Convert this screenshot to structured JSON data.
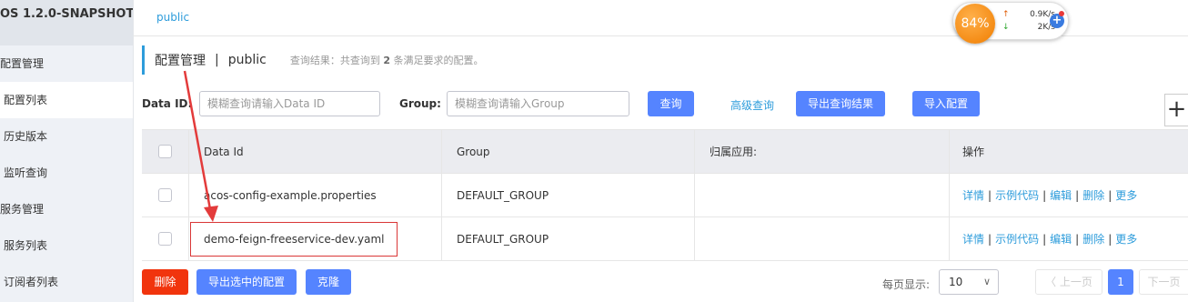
{
  "sidebar": {
    "brand": "OS 1.2.0-SNAPSHOT",
    "group_config": "配置管理",
    "items_config": [
      "配置列表",
      "历史版本",
      "监听查询"
    ],
    "group_service": "服务管理",
    "items_service": [
      "服务列表",
      "订阅者列表"
    ]
  },
  "topbar": {
    "namespace_tab": "public"
  },
  "header": {
    "title": "配置管理",
    "separator": "|",
    "namespace": "public",
    "summary_prefix": "查询结果：共查询到",
    "summary_count": "2",
    "summary_suffix": "条满足要求的配置。"
  },
  "search": {
    "data_id_label": "Data ID:",
    "data_id_placeholder": "模糊查询请输入Data ID",
    "group_label": "Group:",
    "group_placeholder": "模糊查询请输入Group",
    "query_button": "查询",
    "advanced_link": "高级查询",
    "export_results_button": "导出查询结果",
    "import_button": "导入配置",
    "add_icon": "plus-icon"
  },
  "table": {
    "columns": [
      "Data Id",
      "Group",
      "归属应用:",
      "操作"
    ],
    "rows": [
      {
        "data_id": "acos-config-example.properties",
        "group": "DEFAULT_GROUP",
        "app": ""
      },
      {
        "data_id": "demo-feign-freeservice-dev.yaml",
        "group": "DEFAULT_GROUP",
        "app": ""
      }
    ],
    "ops": [
      "详情",
      "示例代码",
      "编辑",
      "删除",
      "更多"
    ]
  },
  "bottom": {
    "delete_button": "删除",
    "export_selected_button": "导出选中的配置",
    "clone_button": "克隆",
    "page_size_label": "每页显示:",
    "page_size_value": "10",
    "prev_label": "〈 上一页",
    "current_page": "1",
    "next_label": "下一页"
  },
  "net_widget": {
    "cpu_percent": "84%",
    "up_speed": "0.9K/s",
    "down_speed": "2K/s"
  },
  "colors": {
    "accent": "#5584ff",
    "link": "#2d9cdb",
    "danger": "#f1340d",
    "annotation": "#d93737"
  }
}
